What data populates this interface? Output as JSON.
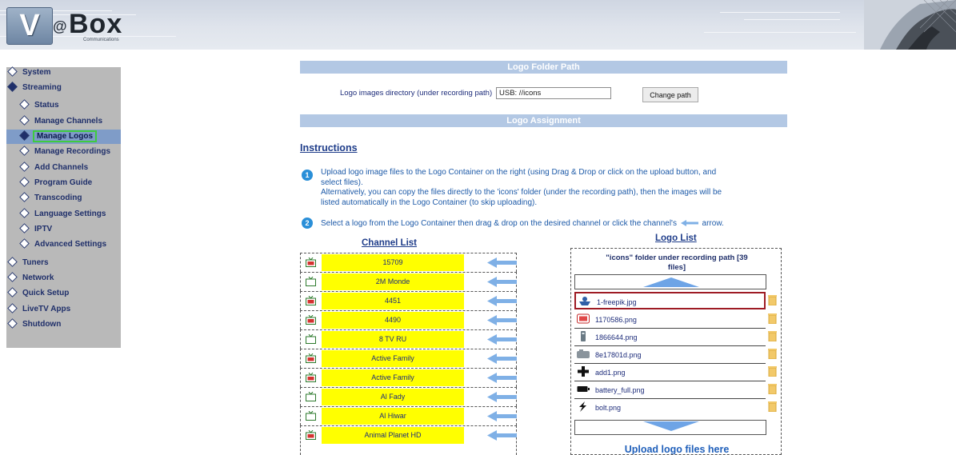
{
  "brand": {
    "letter": "V",
    "at": "@",
    "name": "Box",
    "sub": "Communications"
  },
  "sidebar": {
    "items": [
      {
        "label": "System",
        "level": 0,
        "icon": "diamond-icon"
      },
      {
        "label": "Streaming",
        "level": 0,
        "icon": "diamond-filled-icon"
      },
      {
        "label": "Status",
        "level": 1,
        "icon": "diamond-icon"
      },
      {
        "label": "Manage Channels",
        "level": 1,
        "icon": "diamond-icon"
      },
      {
        "label": "Manage Logos",
        "level": 1,
        "icon": "diamond-filled-icon",
        "active": true
      },
      {
        "label": "Manage Recordings",
        "level": 1,
        "icon": "diamond-icon"
      },
      {
        "label": "Add Channels",
        "level": 1,
        "icon": "diamond-icon"
      },
      {
        "label": "Program Guide",
        "level": 1,
        "icon": "diamond-icon"
      },
      {
        "label": "Transcoding",
        "level": 1,
        "icon": "diamond-icon"
      },
      {
        "label": "Language Settings",
        "level": 1,
        "icon": "diamond-icon"
      },
      {
        "label": "IPTV",
        "level": 1,
        "icon": "diamond-icon"
      },
      {
        "label": "Advanced Settings",
        "level": 1,
        "icon": "diamond-icon"
      },
      {
        "label": "Tuners",
        "level": 0,
        "icon": "diamond-icon"
      },
      {
        "label": "Network",
        "level": 0,
        "icon": "diamond-icon"
      },
      {
        "label": "Quick Setup",
        "level": 0,
        "icon": "diamond-icon"
      },
      {
        "label": "LiveTV Apps",
        "level": 0,
        "icon": "diamond-icon"
      },
      {
        "label": "Shutdown",
        "level": 0,
        "icon": "diamond-icon"
      }
    ]
  },
  "logo_folder": {
    "title": "Logo Folder Path",
    "label": "Logo images directory (under recording path)",
    "value": "USB: //icons",
    "button": "Change path"
  },
  "logo_assignment": {
    "title": "Logo Assignment"
  },
  "instructions": {
    "title": "Instructions",
    "step1_num": "1",
    "step1_l1": "Upload logo image files to the Logo Container on the right (using Drag & Drop or click on the upload button, and",
    "step1_l2": "select files).",
    "step1_l3": "Alternatively, you can copy the files directly to the 'icons' folder (under the recording path), then the images will be",
    "step1_l4": "listed automatically in the Logo Container (to skip uploading).",
    "step2_num": "2",
    "step2_a": "Select a logo from the Logo Container then drag & drop on the desired channel or click the channel's",
    "step2_b": "arrow."
  },
  "channel_list": {
    "title": "Channel List",
    "channels": [
      {
        "name": "15709",
        "icon": "tv-red-icon"
      },
      {
        "name": "2M Monde",
        "icon": "tv-green-icon"
      },
      {
        "name": "4451",
        "icon": "tv-red-icon"
      },
      {
        "name": "4490",
        "icon": "tv-red-icon"
      },
      {
        "name": "8 TV RU",
        "icon": "tv-green-icon"
      },
      {
        "name": "Active Family",
        "icon": "tv-red-icon"
      },
      {
        "name": "Active Family",
        "icon": "tv-red-icon"
      },
      {
        "name": "Al Fady",
        "icon": "tv-green-icon"
      },
      {
        "name": "Al Hiwar",
        "icon": "tv-green-icon"
      },
      {
        "name": "Animal Planet HD",
        "icon": "tv-red-icon"
      }
    ]
  },
  "logo_list": {
    "title": "Logo List",
    "folder_title_l1": "\"icons\" folder under recording path [39",
    "folder_title_l2": "files]",
    "files": [
      {
        "name": "1-freepik.jpg",
        "thumb": "boat-logo-icon",
        "selected": true
      },
      {
        "name": "1170586.png",
        "thumb": "red-tv-logo-icon"
      },
      {
        "name": "1866644.png",
        "thumb": "remote-logo-icon"
      },
      {
        "name": "8e17801d.png",
        "thumb": "camera-logo-icon"
      },
      {
        "name": "add1.png",
        "thumb": "plus-logo-icon"
      },
      {
        "name": "battery_full.png",
        "thumb": "battery-logo-icon"
      },
      {
        "name": "bolt.png",
        "thumb": "bolt-logo-icon"
      }
    ],
    "upload_text": "Upload logo files here"
  },
  "colors": {
    "bar": "#b3c8e4",
    "channel_highlight": "#ffff00",
    "arrow": "#7fb0e6",
    "selected_border": "#9e1b24",
    "active_nav": "#7f9cc8"
  }
}
